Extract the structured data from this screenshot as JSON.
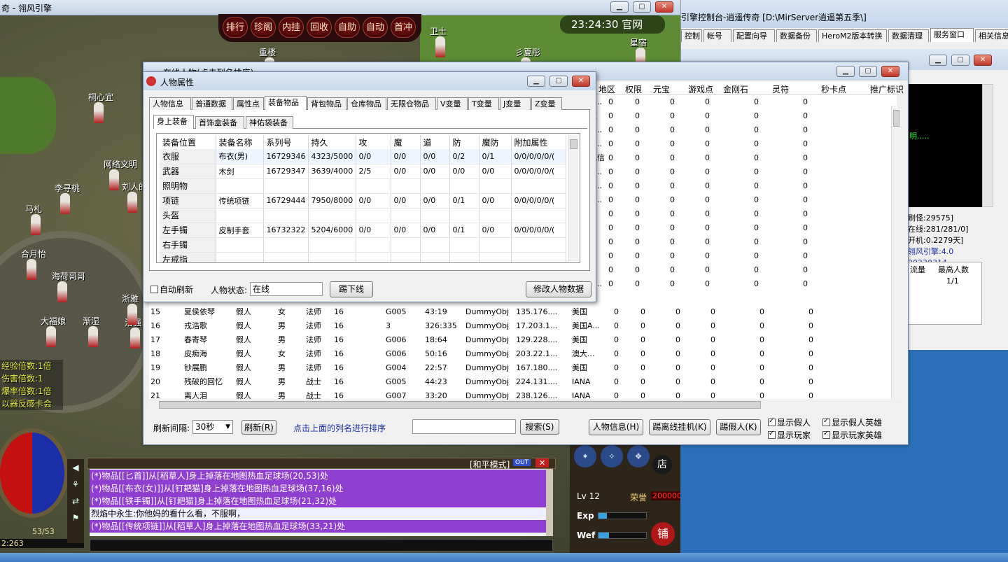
{
  "game": {
    "title": "奇 - 翎风引擎",
    "clock": "23:24:30 官网",
    "top_buttons": [
      "排行",
      "珍阁",
      "内挂",
      "回收",
      "自助",
      "自动",
      "首冲"
    ],
    "overhead": [
      "卫士",
      "重楼",
      "彡夏彤",
      "桐心宜",
      "星宿",
      "网络文明",
      "李寻桃",
      "刘人的",
      "马札",
      "合月怡",
      "海荷哥哥",
      "浩强",
      "大福娘",
      "渐湿",
      "浙雅"
    ],
    "left_stats": [
      "经验倍数:1倍",
      "伤害倍数:1",
      "爆率倍数:1倍",
      "以器反感卡会"
    ],
    "hp": "53/53",
    "coords": "2:263",
    "level": "Lv 12",
    "mode": "[和平模式]",
    "mode_out": "OUT",
    "exp_label": "Exp",
    "wef_label": "Wef",
    "reputation": "荣誉",
    "rep_value": "200000",
    "shop": "店",
    "store": "铺",
    "chat": [
      {
        "type": "sys",
        "text": "(*)物品[[匕首]]从[稻草人]身上掉落在地图热血足球场(20,53)处"
      },
      {
        "type": "sys",
        "text": "(*)物品[[布衣(女)]]从[钉耙猫]身上掉落在地图热血足球场(37,16)处"
      },
      {
        "type": "sys",
        "text": "(*)物品[[铁手镯]]从[钉耙猫]身上掉落在地图热血足球场(21,32)处"
      },
      {
        "type": "ply",
        "text": "烈焰中永生:你他妈的看什么看，不服啊，"
      },
      {
        "type": "sys",
        "text": "(*)物品[[传统项链]]从[稻草人]身上掉落在地图热血足球场(33,21)处"
      }
    ]
  },
  "console": {
    "title": "引擎控制台-逍遥传奇 [D:\\MirServer逍遥第五季\\]",
    "tabs": [
      "控制",
      "帐号",
      "配置向导",
      "数据备份",
      "HeroM2版本转换",
      "数据清理",
      "服务窗口",
      "相关信息"
    ],
    "log": [
      "明....."
    ],
    "info": [
      "刷怪:29575]",
      "在线:281/281/0]",
      "开机:0.2279天]",
      "翎风引擎:4.0 20230314"
    ],
    "traffic_headers": [
      "流量",
      "最高人数"
    ],
    "traffic_row": [
      "",
      "1/1"
    ]
  },
  "online": {
    "title": "在线人物(点击列名排序)",
    "headers": [
      "地区",
      "权限",
      "元宝",
      "游戏点",
      "金刚石",
      "灵符",
      "秒卡点",
      "推广标识"
    ],
    "right_rows": [
      [
        "国A...",
        "0",
        "0",
        "0",
        "0",
        "0",
        "0"
      ],
      [
        "利亚",
        "0",
        "0",
        "0",
        "0",
        "0",
        "0"
      ],
      [
        "国A...",
        "0",
        "0",
        "0",
        "0",
        "0",
        "0"
      ],
      [
        "国A...",
        "0",
        "0",
        "0",
        "0",
        "0",
        "0"
      ],
      [
        "国电信",
        "0",
        "0",
        "0",
        "0",
        "0",
        "0"
      ],
      [
        "国A...",
        "0",
        "0",
        "0",
        "0",
        "0",
        "0"
      ],
      [
        "国A...",
        "0",
        "0",
        "0",
        "0",
        "0",
        "0"
      ],
      [
        "国A...",
        "0",
        "0",
        "0",
        "0",
        "0",
        "0"
      ],
      [
        "国",
        "0",
        "0",
        "0",
        "0",
        "0",
        "0"
      ],
      [
        "国",
        "0",
        "0",
        "0",
        "0",
        "0",
        "0"
      ],
      [
        "国",
        "0",
        "0",
        "0",
        "0",
        "0",
        "0"
      ],
      [
        "国",
        "0",
        "0",
        "0",
        "0",
        "0",
        "0"
      ],
      [
        "国",
        "0",
        "0",
        "0",
        "0",
        "0",
        "0"
      ],
      [
        "国A...",
        "0",
        "0",
        "0",
        "0",
        "0",
        "0"
      ]
    ],
    "rows": [
      [
        "15",
        "夏侯依琴",
        "假人",
        "女",
        "法师",
        "16",
        "G005",
        "43:19",
        "DummyObj",
        "135.176....",
        "美国",
        "0",
        "0",
        "0",
        "0",
        "0",
        "0"
      ],
      [
        "16",
        "戎浩歌",
        "假人",
        "男",
        "法师",
        "16",
        "3",
        "326:335",
        "DummyObj",
        "17.203.1...",
        "美国A...",
        "0",
        "0",
        "0",
        "0",
        "0",
        "0"
      ],
      [
        "17",
        "春寄琴",
        "假人",
        "男",
        "法师",
        "16",
        "G006",
        "18:64",
        "DummyObj",
        "129.228....",
        "美国",
        "0",
        "0",
        "0",
        "0",
        "0",
        "0"
      ],
      [
        "18",
        "皮痴海",
        "假人",
        "女",
        "法师",
        "16",
        "G006",
        "50:16",
        "DummyObj",
        "203.22.1...",
        "澳大...",
        "0",
        "0",
        "0",
        "0",
        "0",
        "0"
      ],
      [
        "19",
        "钞展鹏",
        "假人",
        "男",
        "法师",
        "16",
        "G004",
        "22:57",
        "DummyObj",
        "167.180....",
        "美国",
        "0",
        "0",
        "0",
        "0",
        "0",
        "0"
      ],
      [
        "20",
        "残破的回忆",
        "假人",
        "男",
        "战士",
        "16",
        "G005",
        "44:23",
        "DummyObj",
        "224.131....",
        "IANA",
        "0",
        "0",
        "0",
        "0",
        "0",
        "0"
      ],
      [
        "21",
        "离人泪",
        "假人",
        "男",
        "战士",
        "16",
        "G007",
        "33:20",
        "DummyObj",
        "238.126....",
        "IANA",
        "0",
        "0",
        "0",
        "0",
        "0",
        "0"
      ]
    ],
    "refresh_label": "刷新间隔:",
    "refresh_value": "30秒",
    "refresh_btn": "刷新(R)",
    "sort_hint": "点击上面的列名进行排序",
    "search_btn": "搜索(S)",
    "info_btn": "人物信息(H)",
    "kick_hang_btn": "踢离线挂机(K)",
    "kick_fake_btn": "踢假人(K)",
    "checks": [
      {
        "label": "显示假人",
        "on": true
      },
      {
        "label": "显示玩家",
        "on": true
      },
      {
        "label": "显示假人英雄",
        "on": true
      },
      {
        "label": "显示玩家英雄",
        "on": true
      }
    ]
  },
  "props": {
    "title": "人物属性",
    "tabs": [
      "人物信息",
      "普通数据",
      "属性点",
      "装备物品",
      "背包物品",
      "仓库物品",
      "无限仓物品",
      "V变量",
      "T变量",
      "J变量",
      "Z变量"
    ],
    "subtabs": [
      "身上装备",
      "首饰盒装备",
      "神佑袋装备"
    ],
    "headers": [
      "装备位置",
      "装备名称",
      "系列号",
      "持久",
      "攻",
      "魔",
      "道",
      "防",
      "魔防",
      "附加属性"
    ],
    "rows": [
      [
        "衣服",
        "布衣(男)",
        "16729346",
        "4323/5000",
        "0/0",
        "0/0",
        "0/0",
        "0/2",
        "0/1",
        "0/0/0/0/0/("
      ],
      [
        "武器",
        "木剑",
        "16729347",
        "3639/4000",
        "2/5",
        "0/0",
        "0/0",
        "0/0",
        "0/0",
        "0/0/0/0/0/("
      ],
      [
        "照明物",
        "",
        "",
        "",
        "",
        "",
        "",
        "",
        "",
        ""
      ],
      [
        "项链",
        "传统项链",
        "16729444",
        "7950/8000",
        "0/0",
        "0/0",
        "0/0",
        "0/1",
        "0/0",
        "0/0/0/0/0/("
      ],
      [
        "头盔",
        "",
        "",
        "",
        "",
        "",
        "",
        "",
        "",
        ""
      ],
      [
        "左手镯",
        "皮制手套",
        "16732322",
        "5204/6000",
        "0/0",
        "0/0",
        "0/0",
        "0/1",
        "0/0",
        "0/0/0/0/0/("
      ],
      [
        "右手镯",
        "",
        "",
        "",
        "",
        "",
        "",
        "",
        "",
        ""
      ],
      [
        "左戒指",
        "",
        "",
        "",
        "",
        "",
        "",
        "",
        "",
        ""
      ]
    ],
    "auto_refresh": "自动刷新",
    "status_label": "人物状态:",
    "status_value": "在线",
    "kick_btn": "踢下线",
    "modify_btn": "修改人物数据"
  }
}
